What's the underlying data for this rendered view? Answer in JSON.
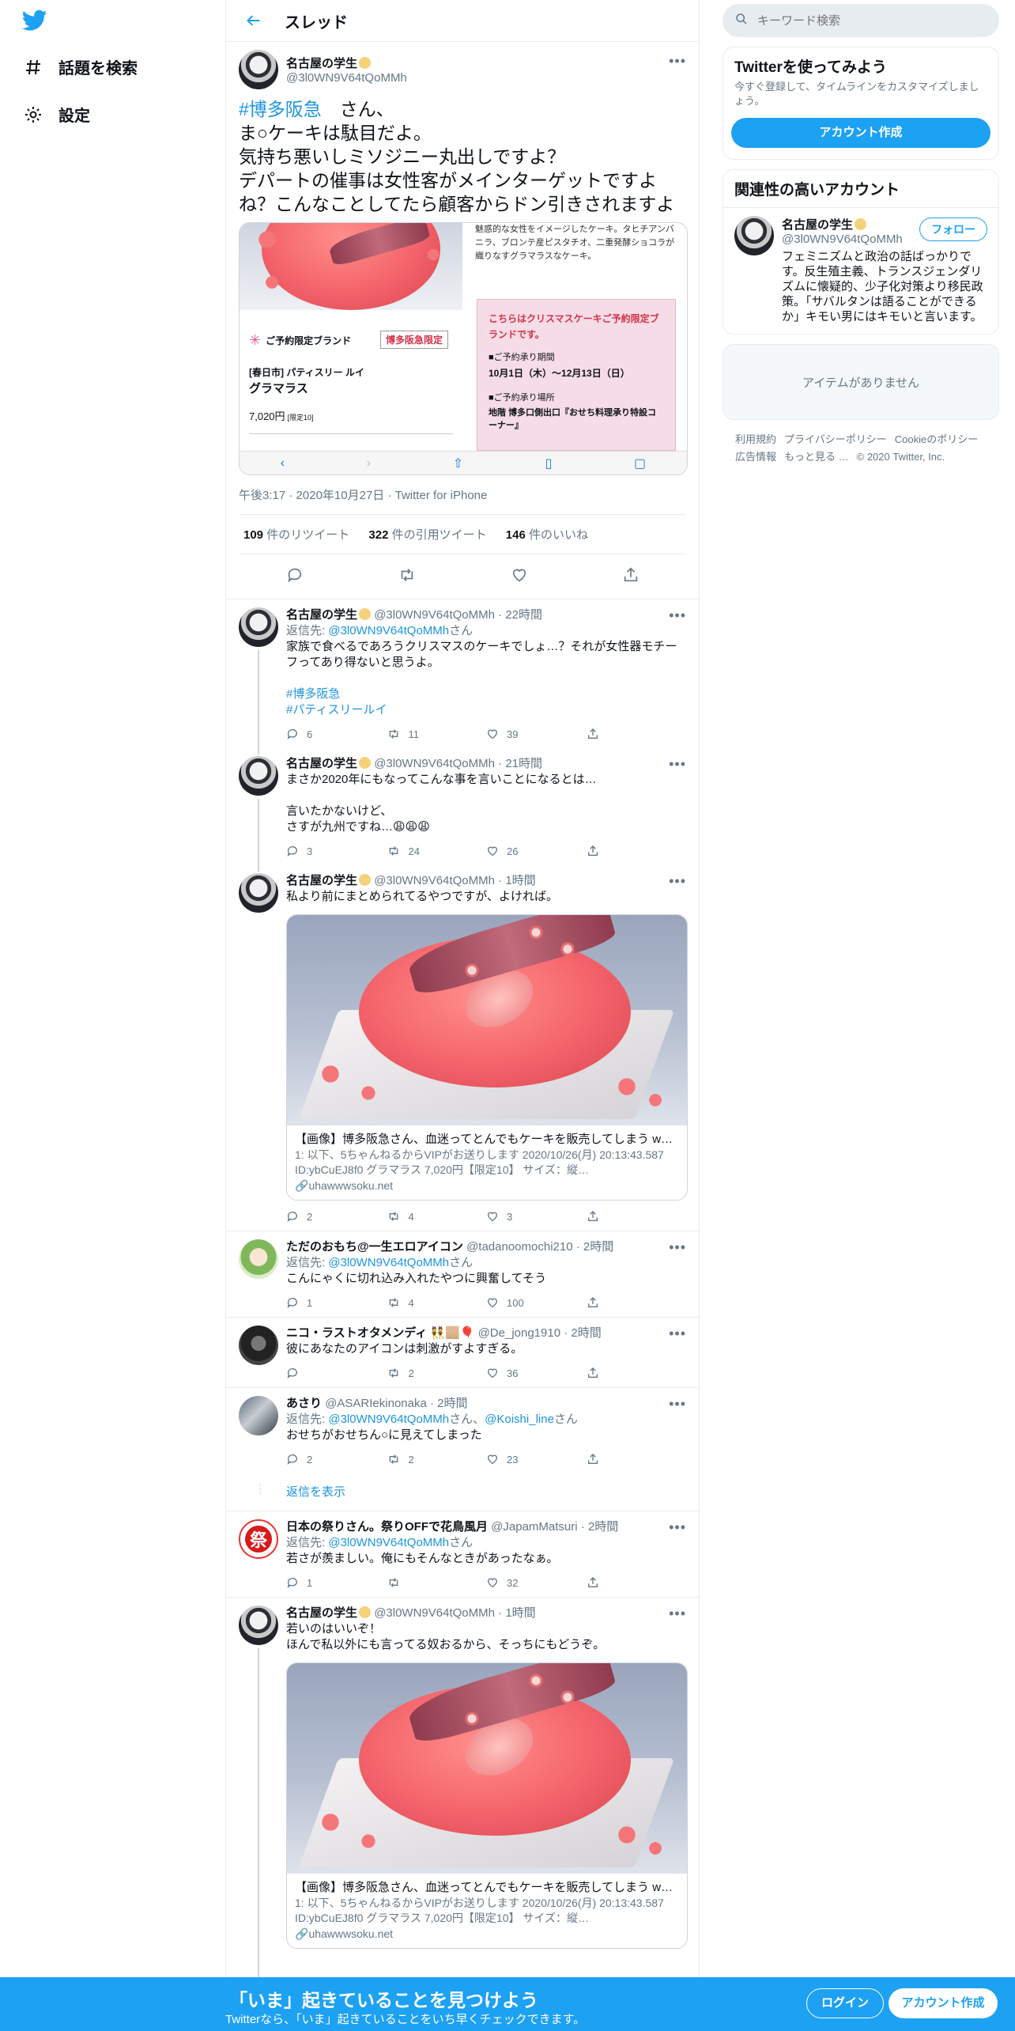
{
  "nav": {
    "explore_label": "話題を検索",
    "settings_label": "設定"
  },
  "header": {
    "title": "スレッド"
  },
  "main_tweet": {
    "name": "名古屋の学生",
    "handle": "@3l0WN9V64tQoMMh",
    "hashtag": "#博多阪急",
    "text_after_hashtag": "　さん、\nま○ケーキは駄目だよ。\n気持ち悪いしミソジニー丸出しですよ？\nデパートの催事は女性客がメインターゲットですよね？こんなことしてたら顧客からドン引きされますよ",
    "image": {
      "description_text": "魅惑的な女性をイメージしたケーキ。タヒチアンバニラ、ブロンテ産ピスタチオ、二重発酵ショコラが織りなすグラマラスなケーキ。",
      "reserve_label": "ご予約限定ブランド",
      "hakata_label": "博多阪急限定",
      "shop_line": "[春日市] パティスリー ルイ",
      "product_name": "グラマラス",
      "price": "7,020円",
      "price_note": "[限定10]",
      "pink_title": "こちらはクリスマスケーキご予約限定ブランドです。",
      "period_label": "■ご予約承り期間",
      "period_value": "10月1日（木）～12月13日（日）",
      "place_label": "■ご予約承り場所",
      "place_value": "地階 博多口側出口『おせち料理承り特設コーナー』"
    },
    "time": "午後3:17",
    "date": "2020年10月27日",
    "source": "Twitter for iPhone",
    "retweets_count": "109",
    "retweets_label": "件のリツイート",
    "quotes_count": "322",
    "quotes_label": "件の引用ツイート",
    "likes_count": "146",
    "likes_label": "件のいいね"
  },
  "replies": [
    {
      "name": "名古屋の学生",
      "handle": "@3l0WN9V64tQoMMh",
      "time": "22時間",
      "replyto_prefix": "返信先: ",
      "replyto_handle": "@3l0WN9V64tQoMMh",
      "replyto_suffix": "さん",
      "text": "家族で食べるであろうクリスマスのケーキでしょ…？それが女性器モチーフってあり得ないと思うよ。",
      "tag1": "#博多阪急",
      "tag2": "#パティスリールイ",
      "replies": "6",
      "retweets": "11",
      "likes": "39"
    },
    {
      "name": "名古屋の学生",
      "handle": "@3l0WN9V64tQoMMh",
      "time": "21時間",
      "text": "まさか2020年にもなってこんな事を言いことになるとは…\n\n言いたかないけど、\nさすが九州ですね…😩😩😩",
      "replies": "3",
      "retweets": "24",
      "likes": "26"
    },
    {
      "name": "名古屋の学生",
      "handle": "@3l0WN9V64tQoMMh",
      "time": "1時間",
      "text": "私より前にまとめられてるやつですが、よければ。",
      "card_title": "【画像】博多阪急さん、血迷ってとんでもケーキを販売してしまう w…",
      "card_desc": "1: 以下、5ちゃんねるからVIPがお送りします 2020/10/26(月) 20:13:43.587 ID:ybCuEJ8f0 グラマラス 7,020円【限定10】 サイズ：縦…",
      "card_url": "uhawwwsoku.net",
      "replies": "2",
      "retweets": "4",
      "likes": "3"
    },
    {
      "name": "ただのおもち@一生エロアイコン",
      "handle": "@tadanoomochi210",
      "time": "2時間",
      "replyto_prefix": "返信先: ",
      "replyto_handle": "@3l0WN9V64tQoMMh",
      "replyto_suffix": "さん",
      "text": "こんにゃくに切れ込み入れたやつに興奮してそう",
      "replies": "1",
      "retweets": "4",
      "likes": "100"
    },
    {
      "name": "ニコ・ラストオタメンディ",
      "handle": "@De_jong1910",
      "time": "2時間",
      "text": "彼にあなたのアイコンは刺激がすよすぎる。",
      "replies": "",
      "retweets": "2",
      "likes": "36"
    },
    {
      "name": "あさり",
      "handle": "@ASARIekinonaka",
      "time": "2時間",
      "replyto_prefix": "返信先: ",
      "replyto_handle": "@3l0WN9V64tQoMMh",
      "replyto_mid": "さん、",
      "replyto_handle2": "@Koishi_line",
      "replyto_suffix": "さん",
      "text": "おせちがおせちん○に見えてしまった",
      "replies": "2",
      "retweets": "2",
      "likes": "23"
    },
    {
      "name": "日本の祭りさん。祭りOFFで花鳥風月",
      "handle": "@JapamMatsuri",
      "time": "2時間",
      "replyto_prefix": "返信先: ",
      "replyto_handle": "@3l0WN9V64tQoMMh",
      "replyto_suffix": "さん",
      "text": "若さが羨ましい。俺にもそんなときがあったなぁ。",
      "avatar_char": "祭",
      "replies": "1",
      "retweets": "",
      "likes": "32"
    },
    {
      "name": "名古屋の学生",
      "handle": "@3l0WN9V64tQoMMh",
      "time": "1時間",
      "text": "若いのはいいぞ！\nほんで私以外にも言ってる奴おるから、そっちにもどうぞ。",
      "card_title": "【画像】博多阪急さん、血迷ってとんでもケーキを販売してしまう w…",
      "card_desc": "1: 以下、5ちゃんねるからVIPがお送りします 2020/10/26(月) 20:13:43.587 ID:ybCuEJ8f0 グラマラス 7,020円【限定10】 サイズ：縦…",
      "card_url": "uhawwwsoku.net"
    }
  ],
  "show_replies_label": "返信を表示",
  "sidebar": {
    "search_placeholder": "キーワード検索",
    "signup_title": "Twitterを使ってみよう",
    "signup_sub": "今すぐ登録して、タイムラインをカスタマイズしましょう。",
    "signup_button": "アカウント作成",
    "related_title": "関連性の高いアカウント",
    "related_name": "名古屋の学生",
    "related_handle": "@3l0WN9V64tQoMMh",
    "follow_button": "フォロー",
    "related_bio": "フェミニズムと政治の話ばっかりです。反生殖主義、トランスジェンダリズムに懐疑的、少子化対策より移民政策。「サバルタンは語ることができるか」キモい男にはキモいと言います。",
    "empty_text": "アイテムがありません",
    "footer": [
      "利用規約",
      "プライバシーポリシー",
      "Cookieのポリシー",
      "広告情報",
      "もっと見る …",
      "© 2020 Twitter, Inc."
    ]
  },
  "bottom_bar": {
    "title": "「いま」起きていることを見つけよう",
    "subtitle": "Twitterなら、「いま」起きていることをいち早くチェックできます。",
    "login": "ログイン",
    "signup": "アカウント作成"
  },
  "colors": {
    "accent": "#1da1f2",
    "link": "#1b95e0",
    "bottom_bar": "#1da1f2"
  }
}
